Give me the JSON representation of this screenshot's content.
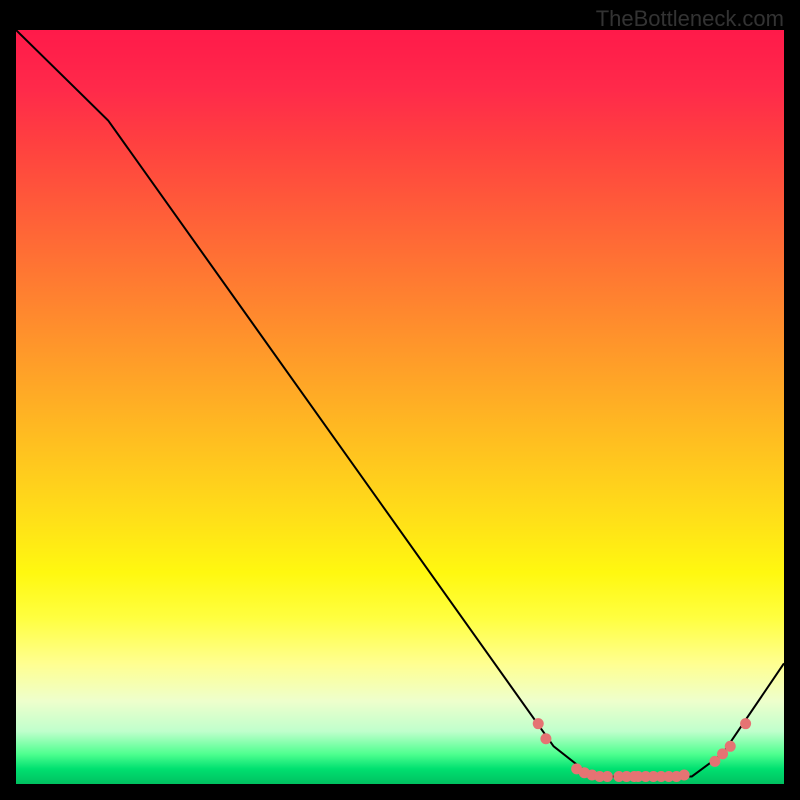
{
  "attribution": "TheBottleneck.com",
  "chart_data": {
    "type": "line",
    "title": "",
    "xlabel": "",
    "ylabel": "",
    "x_range": [
      0,
      100
    ],
    "y_range": [
      0,
      100
    ],
    "curve": [
      {
        "x": 0,
        "y": 100
      },
      {
        "x": 8,
        "y": 92
      },
      {
        "x": 12,
        "y": 88
      },
      {
        "x": 70,
        "y": 5
      },
      {
        "x": 75,
        "y": 1
      },
      {
        "x": 88,
        "y": 1
      },
      {
        "x": 92,
        "y": 4
      },
      {
        "x": 100,
        "y": 16
      }
    ],
    "highlight_points": [
      {
        "x": 68,
        "y": 8
      },
      {
        "x": 69,
        "y": 6
      },
      {
        "x": 73,
        "y": 2
      },
      {
        "x": 74,
        "y": 1.5
      },
      {
        "x": 75,
        "y": 1.2
      },
      {
        "x": 76,
        "y": 1
      },
      {
        "x": 77,
        "y": 1
      },
      {
        "x": 78.5,
        "y": 1
      },
      {
        "x": 79.5,
        "y": 1
      },
      {
        "x": 80.5,
        "y": 1
      },
      {
        "x": 81,
        "y": 1
      },
      {
        "x": 82,
        "y": 1
      },
      {
        "x": 83,
        "y": 1
      },
      {
        "x": 84,
        "y": 1
      },
      {
        "x": 85,
        "y": 1
      },
      {
        "x": 86,
        "y": 1
      },
      {
        "x": 87,
        "y": 1.2
      },
      {
        "x": 91,
        "y": 3
      },
      {
        "x": 92,
        "y": 4
      },
      {
        "x": 93,
        "y": 5
      },
      {
        "x": 95,
        "y": 8
      }
    ],
    "highlight_color": "#e57373",
    "gradient_stops": [
      {
        "pos": 0,
        "color": "#ff1a4a"
      },
      {
        "pos": 15,
        "color": "#ff4040"
      },
      {
        "pos": 35,
        "color": "#ff8030"
      },
      {
        "pos": 55,
        "color": "#ffc020"
      },
      {
        "pos": 72,
        "color": "#fff810"
      },
      {
        "pos": 89,
        "color": "#eeffcc"
      },
      {
        "pos": 96,
        "color": "#50ff90"
      },
      {
        "pos": 100,
        "color": "#00c060"
      }
    ]
  }
}
